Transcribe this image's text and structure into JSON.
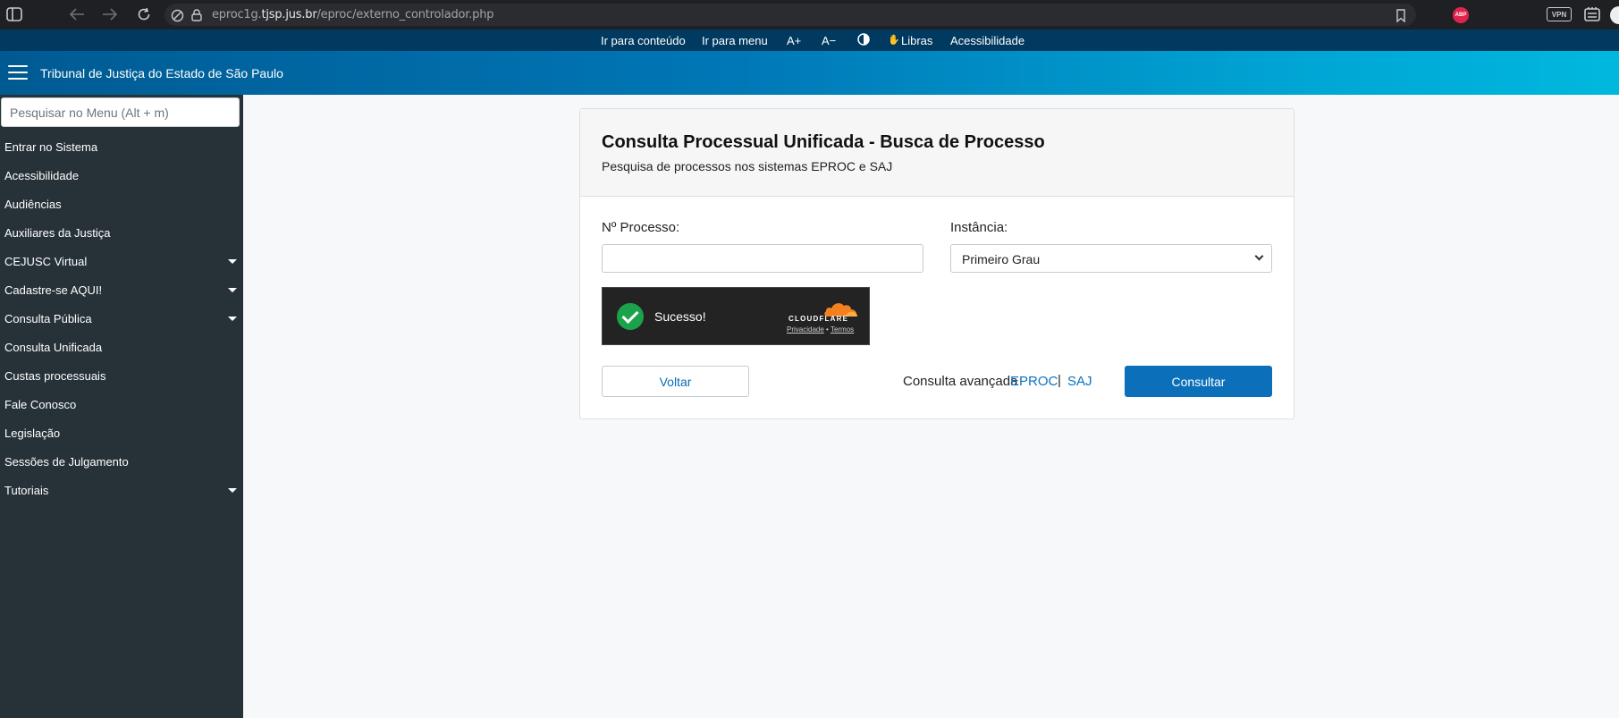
{
  "browser": {
    "url_prefix": "eproc1g.",
    "url_domain": "tjsp.jus.br",
    "url_path": "/eproc/externo_controlador.php",
    "abp_badge": "ABP",
    "vpn_badge": "VPN"
  },
  "accessibility_bar": {
    "items": [
      "Ir para conteúdo",
      "Ir para menu",
      "A+",
      "A−",
      "Libras",
      "Acessibilidade"
    ]
  },
  "header": {
    "title": "Tribunal de Justiça do Estado de São Paulo"
  },
  "sidebar": {
    "search_placeholder": "Pesquisar no Menu (Alt + m)",
    "items": [
      {
        "label": "Entrar no Sistema"
      },
      {
        "label": "Acessibilidade"
      },
      {
        "label": "Audiências"
      },
      {
        "label": "Auxiliares da Justiça"
      },
      {
        "label": "CEJUSC Virtual"
      },
      {
        "label": "Cadastre-se AQUI!"
      },
      {
        "label": "Consulta Pública"
      },
      {
        "label": "Consulta Unificada"
      },
      {
        "label": "Custas processuais"
      },
      {
        "label": "Fale Conosco"
      },
      {
        "label": "Legislação"
      },
      {
        "label": "Sessões de Julgamento"
      },
      {
        "label": "Tutoriais"
      }
    ]
  },
  "form": {
    "title": "Consulta Processual Unificada - Busca de Processo",
    "subtitle": "Pesquisa de processos nos sistemas EPROC e SAJ",
    "processo_label": "Nº Processo:",
    "processo_value": "",
    "instancia_label": "Instância:",
    "instancia_selected": "Primeiro Grau",
    "captcha": {
      "status": "Sucesso!",
      "brand": "CLOUDFLARE",
      "privacy_link": "Privacidade",
      "separator": "•",
      "terms_link": "Termos"
    },
    "back_button": "Voltar",
    "advanced_label": "Consulta avançada",
    "advanced_eproc": "EPROC",
    "advanced_separator": "|",
    "advanced_saj": "SAJ",
    "submit_button": "Consultar"
  },
  "colors": {
    "accessibility_bar": "#003a60",
    "header_start": "#005a92",
    "header_end": "#00b8de",
    "sidebar": "#273238",
    "primary_button": "#0b70b9",
    "link": "#0b72c1"
  }
}
